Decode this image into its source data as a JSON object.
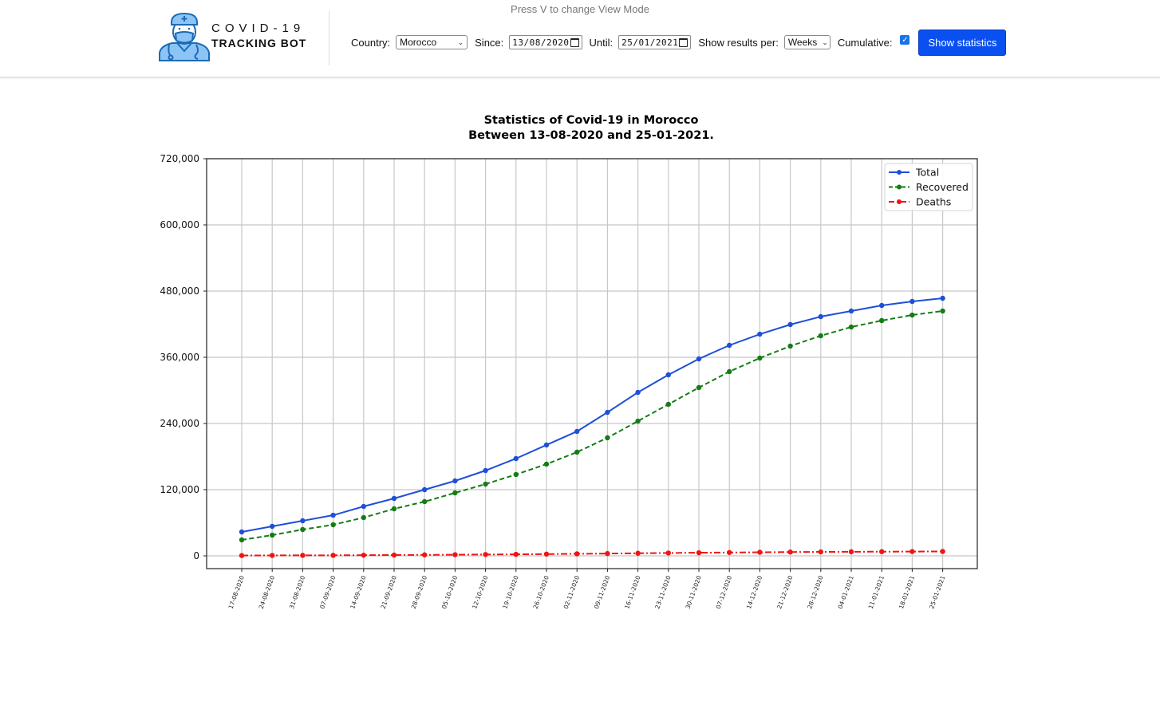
{
  "header": {
    "hint": "Press V to change View Mode",
    "brand_line1": "COVID-19",
    "brand_line2": "TRACKING BOT",
    "logo_icon": "doctor-mask-icon",
    "controls": {
      "country_label": "Country:",
      "country_value": "Morocco",
      "since_label": "Since:",
      "since_value": "13/08/2020",
      "until_label": "Until:",
      "until_value": "25/01/2021",
      "per_label": "Show results per:",
      "per_value": "Weeks",
      "cumulative_label": "Cumulative:",
      "cumulative_checked": true,
      "button_label": "Show statistics"
    },
    "accent_color": "#0a4ff0"
  },
  "chart_data": {
    "type": "line",
    "title": "Statistics of Covid-19 in Morocco",
    "subtitle": "Between 13-08-2020 and 25-01-2021.",
    "xlabel": "",
    "ylabel": "",
    "ylim": [
      0,
      720000
    ],
    "yticks": [
      0,
      120000,
      240000,
      360000,
      480000,
      600000,
      720000
    ],
    "ytick_labels": [
      "0",
      "120,000",
      "240,000",
      "360,000",
      "480,000",
      "600,000",
      "720,000"
    ],
    "grid": true,
    "legend_position": "top-right",
    "x": [
      "17-08-2020",
      "24-08-2020",
      "31-08-2020",
      "07-09-2020",
      "14-09-2020",
      "21-09-2020",
      "28-09-2020",
      "05-10-2020",
      "12-10-2020",
      "19-10-2020",
      "26-10-2020",
      "02-11-2020",
      "09-11-2020",
      "16-11-2020",
      "23-11-2020",
      "30-11-2020",
      "07-12-2020",
      "14-12-2020",
      "21-12-2020",
      "28-12-2020",
      "04-01-2021",
      "11-01-2021",
      "18-01-2021",
      "25-01-2021"
    ],
    "series": [
      {
        "name": "Total",
        "color": "#1f4fd8",
        "style": "solid",
        "values": [
          43400,
          53500,
          63600,
          73700,
          89600,
          104100,
          120000,
          135900,
          154700,
          176400,
          201000,
          225600,
          260200,
          296400,
          328200,
          357100,
          381700,
          401900,
          419300,
          433700,
          443900,
          454000,
          461200,
          467000
        ]
      },
      {
        "name": "Recovered",
        "color": "#137d13",
        "style": "dashed",
        "values": [
          28900,
          37600,
          47700,
          56400,
          69400,
          85300,
          98300,
          114200,
          130100,
          147500,
          166300,
          188000,
          214000,
          244300,
          274700,
          305100,
          334000,
          358600,
          380300,
          399000,
          414900,
          426500,
          436600,
          443900
        ]
      },
      {
        "name": "Deaths",
        "color": "#f01414",
        "style": "dashdot",
        "values": [
          600,
          800,
          900,
          1000,
          1200,
          1500,
          1800,
          2100,
          2500,
          2800,
          3200,
          3700,
          4200,
          4700,
          5200,
          5700,
          6100,
          6500,
          6900,
          7200,
          7400,
          7600,
          7800,
          8000
        ]
      }
    ]
  }
}
